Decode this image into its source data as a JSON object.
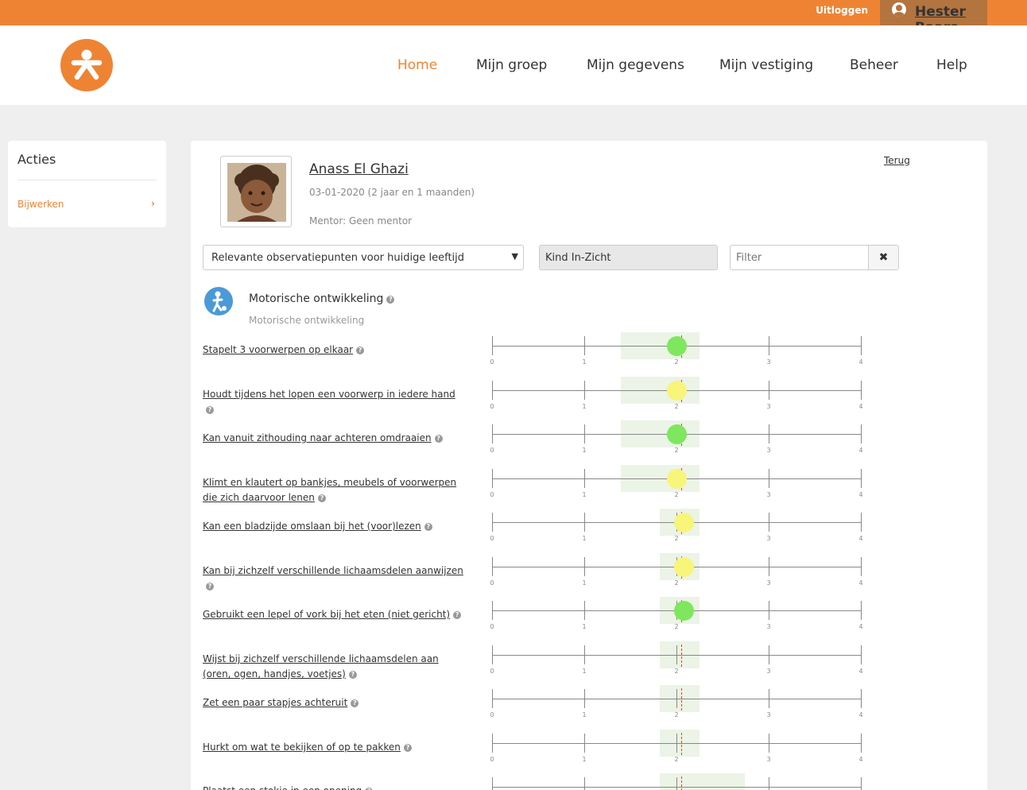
{
  "topbar": {
    "logout_label": "Uitloggen",
    "user_name": "Hester Baars"
  },
  "nav": {
    "items": [
      "Home",
      "Mijn groep",
      "Mijn gegevens",
      "Mijn vestiging",
      "Beheer",
      "Help"
    ],
    "active": "Home"
  },
  "sidebar": {
    "title": "Acties",
    "link_label": "Bijwerken",
    "chevron": "›"
  },
  "child": {
    "name": "Anass El Ghazi",
    "dob": "03-01-2020 (2 jaar en 1 maanden)",
    "mentor": "Mentor: Geen mentor",
    "back_label": "Terug"
  },
  "filters": {
    "select_value": "Relevante observatiepunten voor huidige leeftijd",
    "method_value": "Kind In-Zicht",
    "filter_placeholder": "Filter",
    "clear_icon": "✖"
  },
  "domain": {
    "title": "Motorische ontwikkeling",
    "subtitle": "Motorische ontwikkeling",
    "help": "?"
  },
  "colors": {
    "brand": "#ee8433",
    "green": "#7ee75e",
    "yellow": "#f7f57a",
    "band": "#ebf4e6",
    "reference": "#d9452b"
  },
  "scale": {
    "ticks": [
      "0",
      "1",
      "2",
      "3",
      "4"
    ]
  },
  "observations": [
    {
      "label": "Stapelt 3 voorwerpen op elkaar",
      "band": [
        1.4,
        2.25
      ],
      "reference": 2.05,
      "score": 2.0,
      "status": "green"
    },
    {
      "label": "Houdt tijdens het lopen een voorwerp in iedere hand",
      "band": [
        1.4,
        2.25
      ],
      "reference": 2.05,
      "score": 2.0,
      "status": "yellow"
    },
    {
      "label": "Kan vanuit zithouding naar achteren omdraaien",
      "band": [
        1.4,
        2.25
      ],
      "reference": 2.05,
      "score": 2.0,
      "status": "green"
    },
    {
      "label": "Klimt en klautert op bankjes, meubels of voorwerpen die zich daarvoor lenen",
      "band": [
        1.4,
        2.25
      ],
      "reference": 2.05,
      "score": 2.0,
      "status": "yellow"
    },
    {
      "label": "Kan een bladzijde omslaan bij het (voor)lezen",
      "band": [
        1.82,
        2.25
      ],
      "reference": 2.05,
      "score": 2.08,
      "status": "yellow"
    },
    {
      "label": "Kan bij zichzelf verschillende lichaamsdelen aanwijzen",
      "band": [
        1.82,
        2.25
      ],
      "reference": 2.05,
      "score": 2.08,
      "status": "yellow"
    },
    {
      "label": "Gebruikt een lepel of vork bij het eten (niet gericht)",
      "band": [
        1.82,
        2.25
      ],
      "reference": 2.05,
      "score": 2.08,
      "status": "green"
    },
    {
      "label": "Wijst bij zichzelf verschillende lichaamsdelen aan (oren, ogen, handjes, voetjes)",
      "band": [
        1.82,
        2.25
      ],
      "reference": 2.05,
      "score": null,
      "status": "none"
    },
    {
      "label": "Zet een paar stapjes achteruit",
      "band": [
        1.82,
        2.25
      ],
      "reference": 2.05,
      "score": null,
      "status": "none"
    },
    {
      "label": "Hurkt om wat te bekijken of op te pakken",
      "band": [
        1.82,
        2.25
      ],
      "reference": 2.05,
      "score": null,
      "status": "none"
    },
    {
      "label": "Plaatst een stokje in een opening",
      "band": [
        1.82,
        2.74
      ],
      "reference": 2.05,
      "score": null,
      "status": "none"
    }
  ]
}
